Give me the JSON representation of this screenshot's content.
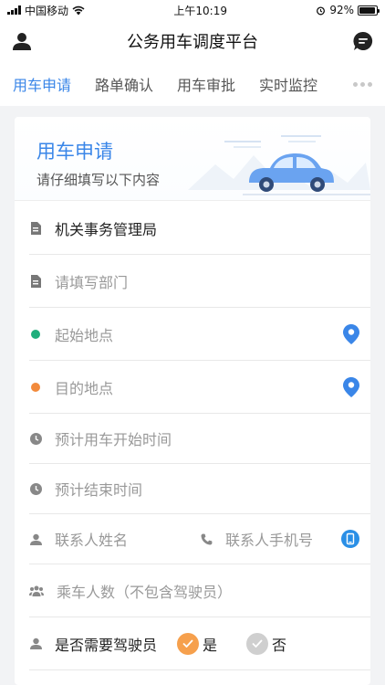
{
  "status_bar": {
    "carrier": "中国移动",
    "time": "上午10:19",
    "battery": "92%",
    "battery_level": 0.92
  },
  "header": {
    "title": "公务用车调度平台",
    "left_icon": "user-icon",
    "right_icon": "chat-icon"
  },
  "tabs": [
    {
      "label": "用车申请",
      "active": true
    },
    {
      "label": "路单确认",
      "active": false
    },
    {
      "label": "用车审批",
      "active": false
    },
    {
      "label": "实时监控",
      "active": false
    }
  ],
  "banner": {
    "title": "用车申请",
    "subtitle": "请仔细填写以下内容"
  },
  "form": {
    "org": {
      "value": "机关事务管理局"
    },
    "dept": {
      "placeholder": "请填写部门"
    },
    "start_location": {
      "placeholder": "起始地点"
    },
    "destination": {
      "placeholder": "目的地点"
    },
    "start_time": {
      "placeholder": "预计用车开始时间"
    },
    "end_time": {
      "placeholder": "预计结束时间"
    },
    "contact_name": {
      "placeholder": "联系人姓名"
    },
    "contact_phone": {
      "placeholder": "联系人手机号"
    },
    "passengers": {
      "placeholder": "乘车人数（不包含驾驶员）"
    },
    "need_driver": {
      "label": "是否需要驾驶员",
      "yes": "是",
      "no": "否",
      "selected": "是"
    }
  },
  "colors": {
    "accent": "#3a86e8",
    "green_dot": "#1fae7c",
    "orange_dot": "#f28a3c",
    "pin": "#3a86e8",
    "radio_on": "#f6a04d",
    "radio_off": "#cfcfcf"
  }
}
